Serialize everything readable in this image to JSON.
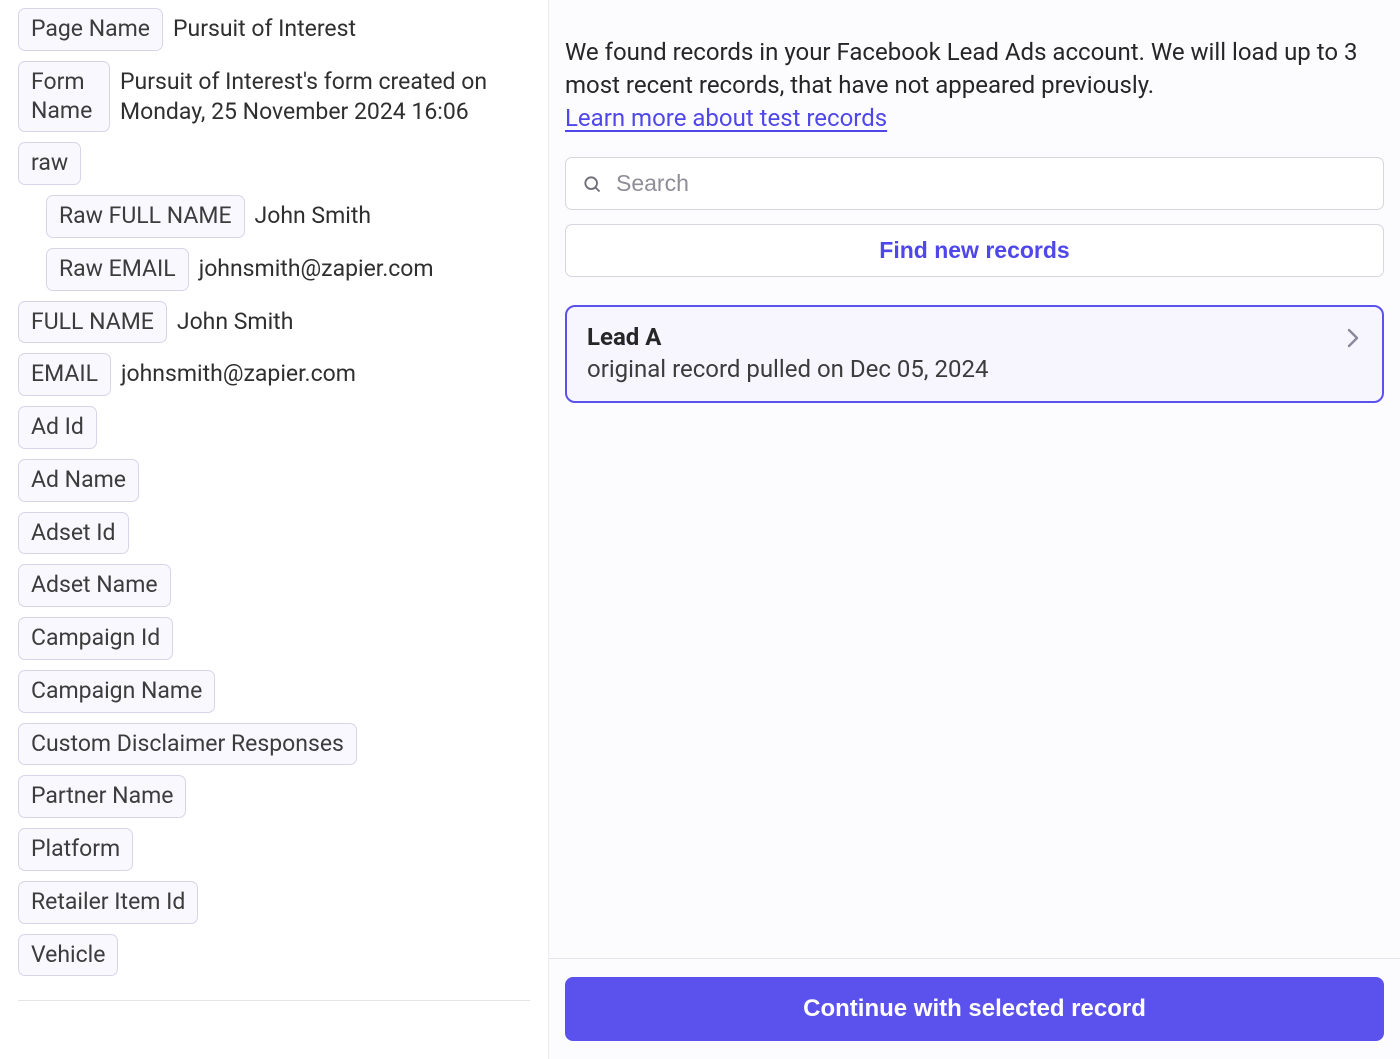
{
  "left": {
    "fields": [
      {
        "label": "Page Name",
        "value": "Pursuit of Interest"
      },
      {
        "label": "Form Name",
        "value": "Pursuit of Interest's form created on Monday, 25 November 2024 16:06",
        "multiline": true
      },
      {
        "label": "raw",
        "value": ""
      }
    ],
    "raw_children": [
      {
        "label": "Raw FULL NAME",
        "value": "John Smith"
      },
      {
        "label": "Raw EMAIL",
        "value": "johnsmith@zapier.com"
      }
    ],
    "extra": [
      {
        "label": "FULL NAME",
        "value": "John Smith"
      },
      {
        "label": "EMAIL",
        "value": "johnsmith@zapier.com"
      },
      {
        "label": "Ad Id",
        "value": ""
      },
      {
        "label": "Ad Name",
        "value": ""
      },
      {
        "label": "Adset Id",
        "value": ""
      },
      {
        "label": "Adset Name",
        "value": ""
      },
      {
        "label": "Campaign Id",
        "value": ""
      },
      {
        "label": "Campaign Name",
        "value": ""
      },
      {
        "label": "Custom Disclaimer Responses",
        "value": ""
      },
      {
        "label": "Partner Name",
        "value": ""
      },
      {
        "label": "Platform",
        "value": ""
      },
      {
        "label": "Retailer Item Id",
        "value": ""
      },
      {
        "label": "Vehicle",
        "value": ""
      }
    ]
  },
  "right": {
    "info_text": "We found records in your Facebook Lead Ads account. We will load up to 3 most recent records, that have not appeared previously.",
    "learn_link": "Learn more about test records",
    "search_placeholder": "Search",
    "find_button": "Find new records",
    "record": {
      "title": "Lead A",
      "subtitle": "original record pulled on Dec 05, 2024"
    },
    "continue_button": "Continue with selected record"
  }
}
